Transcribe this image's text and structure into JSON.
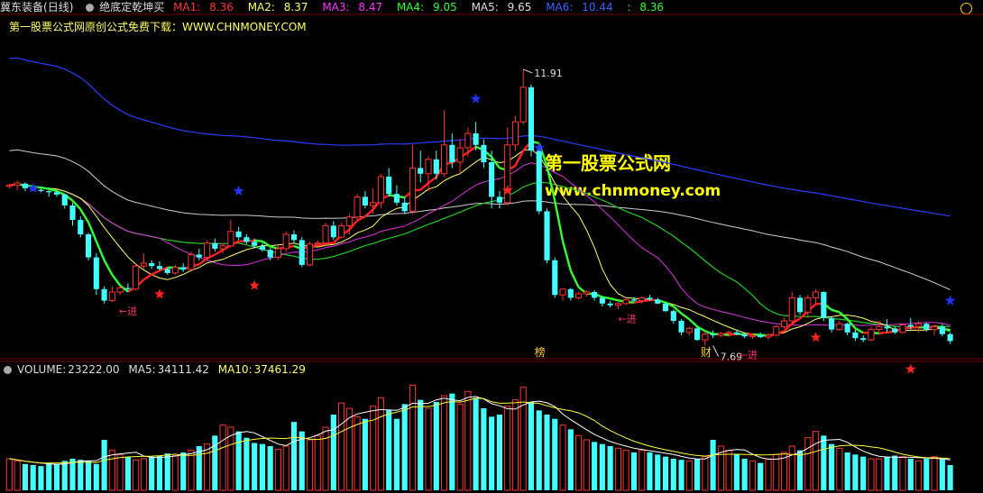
{
  "header": {
    "stock_name": "冀东装备",
    "period": "(日线)",
    "indicator": "绝底定乾坤买",
    "ma": [
      {
        "label": "MA1:",
        "value": "8.36",
        "color": "#ff3333"
      },
      {
        "label": "MA2:",
        "value": "8.37",
        "color": "#ffff66"
      },
      {
        "label": "MA3:",
        "value": "8.47",
        "color": "#ff33ff"
      },
      {
        "label": "MA4:",
        "value": "9.05",
        "color": "#33ff33"
      },
      {
        "label": "MA5:",
        "value": "9.65",
        "color": "#dddddd"
      },
      {
        "label": "MA6:",
        "value": "10.44",
        "color": "#3333ff"
      },
      {
        "label": ":",
        "value": "8.36",
        "color": "#33ff33"
      }
    ]
  },
  "subheader": "第一股票公式网原创公式免费下载：WWW.CHNMONEY.COM",
  "watermark": {
    "line1": "第一股票公式网",
    "line2": "www.chnmoney.com"
  },
  "volume_header": {
    "label": "VOLUME:",
    "value": "23222.00",
    "ma5_label": "MA5:",
    "ma5": "34111.42",
    "ma10_label": "MA10:",
    "ma10": "37461.29"
  },
  "chart_data": {
    "type": "candlestick",
    "annotations": {
      "high_label": "11.91",
      "low_label": "7.69",
      "entry_label": "←进",
      "marker_bang": "榜",
      "marker_cai": "财"
    },
    "price_range": [
      7.3,
      12.3
    ],
    "candles": [
      [
        9.88,
        9.92,
        9.85,
        9.9
      ],
      [
        9.9,
        9.98,
        9.82,
        9.94
      ],
      [
        9.93,
        9.95,
        9.8,
        9.85
      ],
      [
        9.85,
        9.9,
        9.8,
        9.82
      ],
      [
        9.82,
        9.86,
        9.78,
        9.8
      ],
      [
        9.8,
        9.82,
        9.7,
        9.78
      ],
      [
        9.78,
        9.8,
        9.7,
        9.74
      ],
      [
        9.74,
        9.76,
        9.5,
        9.55
      ],
      [
        9.55,
        9.6,
        9.2,
        9.3
      ],
      [
        9.3,
        9.36,
        9.0,
        9.05
      ],
      [
        9.05,
        9.08,
        8.6,
        8.65
      ],
      [
        8.65,
        8.72,
        8.0,
        8.1
      ],
      [
        8.1,
        8.15,
        7.85,
        7.9
      ],
      [
        7.9,
        8.15,
        7.88,
        8.05
      ],
      [
        8.05,
        8.15,
        8.0,
        8.12
      ],
      [
        8.12,
        8.2,
        8.05,
        8.1
      ],
      [
        8.1,
        8.55,
        8.08,
        8.5
      ],
      [
        8.5,
        8.72,
        8.45,
        8.55
      ],
      [
        8.55,
        8.6,
        8.45,
        8.5
      ],
      [
        8.5,
        8.58,
        8.42,
        8.45
      ],
      [
        8.45,
        8.48,
        8.35,
        8.38
      ],
      [
        8.38,
        8.52,
        8.35,
        8.48
      ],
      [
        8.48,
        8.55,
        8.4,
        8.44
      ],
      [
        8.44,
        8.75,
        8.42,
        8.7
      ],
      [
        8.7,
        8.8,
        8.6,
        8.65
      ],
      [
        8.65,
        8.95,
        8.6,
        8.9
      ],
      [
        8.9,
        8.98,
        8.75,
        8.8
      ],
      [
        8.8,
        8.9,
        8.72,
        8.85
      ],
      [
        8.85,
        9.3,
        8.82,
        9.1
      ],
      [
        9.1,
        9.18,
        8.95,
        9.0
      ],
      [
        9.0,
        9.05,
        8.88,
        8.92
      ],
      [
        8.92,
        8.98,
        8.8,
        8.85
      ],
      [
        8.85,
        8.9,
        8.75,
        8.78
      ],
      [
        8.78,
        8.82,
        8.6,
        8.65
      ],
      [
        8.65,
        8.85,
        8.6,
        8.8
      ],
      [
        8.8,
        9.1,
        8.75,
        9.05
      ],
      [
        9.05,
        9.12,
        8.9,
        8.95
      ],
      [
        8.95,
        9.0,
        8.48,
        8.52
      ],
      [
        8.52,
        8.92,
        8.5,
        8.88
      ],
      [
        8.88,
        8.95,
        8.82,
        8.9
      ],
      [
        8.9,
        9.25,
        8.85,
        9.2
      ],
      [
        9.2,
        9.28,
        8.95,
        9.0
      ],
      [
        9.0,
        9.25,
        8.98,
        9.2
      ],
      [
        9.2,
        9.4,
        9.05,
        9.35
      ],
      [
        9.35,
        9.75,
        9.3,
        9.7
      ],
      [
        9.7,
        9.8,
        9.5,
        9.55
      ],
      [
        9.55,
        9.85,
        9.4,
        9.6
      ],
      [
        9.6,
        10.1,
        9.5,
        10.05
      ],
      [
        10.05,
        10.2,
        9.7,
        9.75
      ],
      [
        9.75,
        9.9,
        9.55,
        9.6
      ],
      [
        9.6,
        9.7,
        9.4,
        9.45
      ],
      [
        9.45,
        10.6,
        9.4,
        10.2
      ],
      [
        10.2,
        10.5,
        9.95,
        10.1
      ],
      [
        10.1,
        10.4,
        9.8,
        10.35
      ],
      [
        10.35,
        10.5,
        10.0,
        10.1
      ],
      [
        10.1,
        11.2,
        10.05,
        10.6
      ],
      [
        10.6,
        10.8,
        10.2,
        10.3
      ],
      [
        10.3,
        10.7,
        10.1,
        10.55
      ],
      [
        10.55,
        10.9,
        10.4,
        10.8
      ],
      [
        10.8,
        11.0,
        10.5,
        10.6
      ],
      [
        10.6,
        10.7,
        10.2,
        10.3
      ],
      [
        10.3,
        10.5,
        9.5,
        9.7
      ],
      [
        9.7,
        9.8,
        9.5,
        9.6
      ],
      [
        9.6,
        10.9,
        9.55,
        10.6
      ],
      [
        10.6,
        11.1,
        10.5,
        11.0
      ],
      [
        11.0,
        11.91,
        10.95,
        11.6
      ],
      [
        11.6,
        11.65,
        10.4,
        10.5
      ],
      [
        10.5,
        10.55,
        9.4,
        9.45
      ],
      [
        9.45,
        9.5,
        8.55,
        8.6
      ],
      [
        8.6,
        8.65,
        7.95,
        8.0
      ],
      [
        8.0,
        8.12,
        7.9,
        8.1
      ],
      [
        8.1,
        8.12,
        7.9,
        7.95
      ],
      [
        7.95,
        8.05,
        7.92,
        8.02
      ],
      [
        8.02,
        8.08,
        7.97,
        8.05
      ],
      [
        8.05,
        8.08,
        7.9,
        7.95
      ],
      [
        7.95,
        7.98,
        7.8,
        7.85
      ],
      [
        7.85,
        7.9,
        7.78,
        7.82
      ],
      [
        7.82,
        7.88,
        7.75,
        7.85
      ],
      [
        7.85,
        7.95,
        7.82,
        7.92
      ],
      [
        7.92,
        7.96,
        7.88,
        7.9
      ],
      [
        7.9,
        7.98,
        7.85,
        7.95
      ],
      [
        7.95,
        8.0,
        7.9,
        7.92
      ],
      [
        7.92,
        7.95,
        7.84,
        7.85
      ],
      [
        7.85,
        7.88,
        7.7,
        7.72
      ],
      [
        7.72,
        7.75,
        7.5,
        7.55
      ],
      [
        7.55,
        7.58,
        7.3,
        7.35
      ],
      [
        7.35,
        7.45,
        7.3,
        7.42
      ],
      [
        7.42,
        7.45,
        7.2,
        7.22
      ],
      [
        7.22,
        7.35,
        7.12,
        7.32
      ],
      [
        7.32,
        7.38,
        7.25,
        7.3
      ],
      [
        7.3,
        7.36,
        7.27,
        7.33
      ],
      [
        7.33,
        7.38,
        7.28,
        7.35
      ],
      [
        7.35,
        7.4,
        7.3,
        7.32
      ],
      [
        7.32,
        7.35,
        7.25,
        7.28
      ],
      [
        7.28,
        7.33,
        7.24,
        7.3
      ],
      [
        7.3,
        7.35,
        7.25,
        7.27
      ],
      [
        7.27,
        7.33,
        7.22,
        7.3
      ],
      [
        7.3,
        7.48,
        7.28,
        7.45
      ],
      [
        7.45,
        7.6,
        7.42,
        7.55
      ],
      [
        7.55,
        8.05,
        7.5,
        7.95
      ],
      [
        7.95,
        8.0,
        7.65,
        7.7
      ],
      [
        7.7,
        8.0,
        7.6,
        7.95
      ],
      [
        7.95,
        8.1,
        7.85,
        8.05
      ],
      [
        8.05,
        8.06,
        7.55,
        7.6
      ],
      [
        7.6,
        7.62,
        7.35,
        7.4
      ],
      [
        7.4,
        7.55,
        7.38,
        7.5
      ],
      [
        7.5,
        7.52,
        7.3,
        7.35
      ],
      [
        7.35,
        7.4,
        7.2,
        7.25
      ],
      [
        7.25,
        7.3,
        7.18,
        7.22
      ],
      [
        7.22,
        7.45,
        7.2,
        7.4
      ],
      [
        7.4,
        7.55,
        7.36,
        7.45
      ],
      [
        7.45,
        7.58,
        7.35,
        7.42
      ],
      [
        7.42,
        7.46,
        7.32,
        7.35
      ],
      [
        7.35,
        7.5,
        7.33,
        7.48
      ],
      [
        7.48,
        7.6,
        7.4,
        7.45
      ],
      [
        7.45,
        7.55,
        7.35,
        7.5
      ],
      [
        7.5,
        7.52,
        7.36,
        7.4
      ],
      [
        7.4,
        7.48,
        7.3,
        7.45
      ],
      [
        7.45,
        7.5,
        7.28,
        7.32
      ],
      [
        7.32,
        7.35,
        7.15,
        7.2
      ]
    ],
    "volume": [
      300,
      280,
      250,
      240,
      230,
      260,
      250,
      280,
      300,
      290,
      280,
      250,
      480,
      380,
      340,
      320,
      290,
      300,
      320,
      330,
      350,
      330,
      360,
      380,
      420,
      440,
      520,
      620,
      600,
      560,
      500,
      450,
      440,
      420,
      390,
      420,
      650,
      560,
      480,
      520,
      600,
      720,
      830,
      780,
      700,
      680,
      800,
      880,
      760,
      680,
      820,
      1000,
      860,
      780,
      840,
      900,
      920,
      820,
      940,
      880,
      780,
      700,
      720,
      800,
      860,
      980,
      840,
      760,
      720,
      680,
      620,
      580,
      520,
      480,
      460,
      440,
      420,
      400,
      380,
      360,
      380,
      360,
      340,
      320,
      300,
      290,
      280,
      300,
      320,
      480,
      420,
      380,
      340,
      300,
      280,
      260,
      300,
      340,
      360,
      420,
      380,
      500,
      560,
      520,
      440,
      400,
      360,
      340,
      320,
      300,
      300,
      320,
      330,
      320,
      300,
      280,
      300,
      320,
      300,
      240
    ]
  }
}
